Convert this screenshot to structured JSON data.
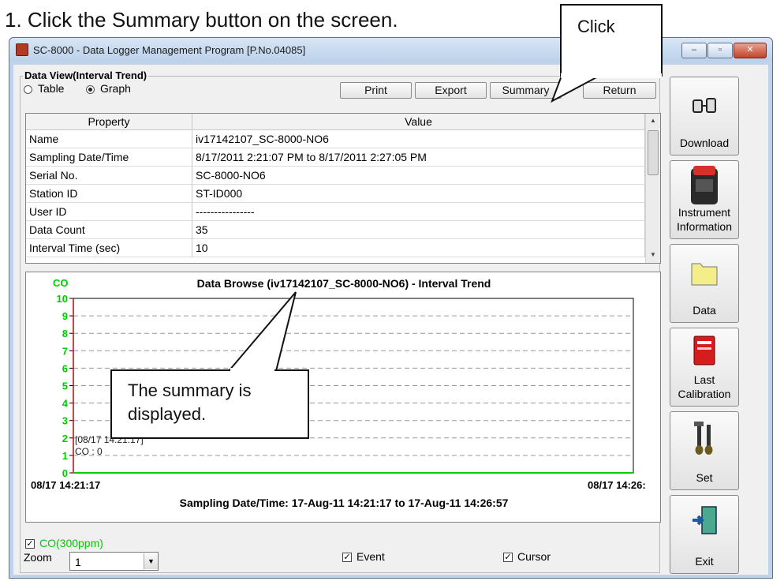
{
  "instruction": "1.  Click the Summary button on the screen.",
  "window": {
    "title": "SC-8000  - Data Logger Management Program [P.No.04085]",
    "controls": {
      "minimize": "–",
      "maximize": "▫",
      "close": "✕"
    }
  },
  "group_title": "Data View(Interval Trend)",
  "view_mode": {
    "table_label": "Table",
    "graph_label": "Graph",
    "selected": "Graph"
  },
  "toolbar": {
    "print": "Print",
    "export": "Export",
    "summary": "Summary",
    "return": "Return"
  },
  "property_table": {
    "headers": [
      "Property",
      "Value"
    ],
    "rows": [
      [
        "Name",
        "iv17142107_SC-8000-NO6"
      ],
      [
        "Sampling Date/Time",
        "8/17/2011 2:21:07 PM to 8/17/2011 2:27:05 PM"
      ],
      [
        "Serial No.",
        "SC-8000-NO6"
      ],
      [
        "Station ID",
        "ST-ID000"
      ],
      [
        "User ID",
        "----------------"
      ],
      [
        "Data Count",
        "35"
      ],
      [
        "Interval Time (sec)",
        "10"
      ]
    ]
  },
  "chart": {
    "title": "Data Browse (iv17142107_SC-8000-NO6) - Interval Trend",
    "y_label": "CO",
    "x_start_label": "08/17 14:21:17",
    "x_end_label": "08/17 14:26:",
    "footer": "Sampling Date/Time: 17-Aug-11 14:21:17 to 17-Aug-11 14:26:57",
    "cursor_label_line1": "[08/17 14:21:17]",
    "cursor_label_line2": "CO : 0",
    "colors": {
      "axis_label": "#00cc00",
      "series": "#00cc00",
      "cursor": "#cc0000",
      "grid": "#999999"
    }
  },
  "chart_data": {
    "type": "line",
    "title": "Data Browse (iv17142107_SC-8000-NO6) - Interval Trend",
    "xlabel": "Sampling Date/Time: 17-Aug-11 14:21:17 to 17-Aug-11 14:26:57",
    "ylabel": "CO",
    "ylim": [
      0,
      10
    ],
    "yticks": [
      0,
      1,
      2,
      3,
      4,
      5,
      6,
      7,
      8,
      9,
      10
    ],
    "x_ticks": [
      "08/17 14:21:17",
      "08/17 14:26:"
    ],
    "grid": true,
    "series": [
      {
        "name": "CO",
        "values": [
          0,
          0,
          0,
          0,
          0,
          0,
          0,
          0,
          0,
          0,
          0,
          0,
          0,
          0,
          0,
          0,
          0,
          0,
          0,
          0,
          0,
          0,
          0,
          0,
          0,
          0,
          0,
          0,
          0,
          0,
          0,
          0,
          0,
          0,
          0
        ]
      }
    ]
  },
  "legend_item": {
    "label": "CO(300ppm)",
    "checked": true
  },
  "zoom": {
    "label": "Zoom",
    "value": "1"
  },
  "event": {
    "label": "Event",
    "checked": true
  },
  "cursor": {
    "label": "Cursor",
    "checked": true
  },
  "sidebar": [
    {
      "label_lines": [
        "",
        "Download"
      ],
      "icon": "download-icon"
    },
    {
      "label_lines": [
        "Instrument",
        "Information"
      ],
      "icon": "instrument-icon"
    },
    {
      "label_lines": [
        "",
        "Data"
      ],
      "icon": "folder-icon"
    },
    {
      "label_lines": [
        "Last",
        "Calibration"
      ],
      "icon": "calibration-book-icon"
    },
    {
      "label_lines": [
        "",
        "Set"
      ],
      "icon": "tools-icon"
    },
    {
      "label_lines": [
        "",
        "Exit"
      ],
      "icon": "exit-door-icon"
    }
  ],
  "callouts": {
    "click": "Click",
    "summary_line1": "The summary is",
    "summary_line2": "displayed."
  }
}
